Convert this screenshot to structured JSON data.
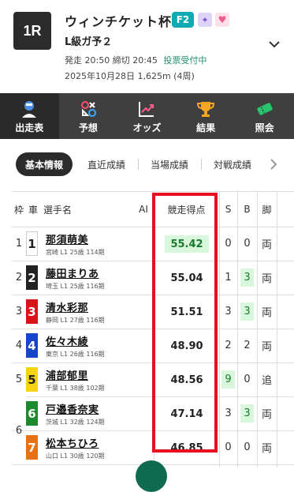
{
  "header": {
    "race_number": "1R",
    "title": "ウィンチケット杯",
    "grade": "F2",
    "race_name": "L級ガ予２",
    "start_time": "発走 20:50",
    "deadline": "締切 20:45",
    "vote_status": "投票受付中",
    "date_line": "2025年10月28日 1,625m (4周)"
  },
  "nav": [
    {
      "label": "出走表",
      "icon": "racer-icon",
      "active": true
    },
    {
      "label": "予想",
      "icon": "prediction-icon",
      "active": false
    },
    {
      "label": "オッズ",
      "icon": "odds-chart-icon",
      "active": false
    },
    {
      "label": "結果",
      "icon": "trophy-icon",
      "active": false
    },
    {
      "label": "照会",
      "icon": "ticket-icon",
      "active": false
    }
  ],
  "tabs": [
    "基本情報",
    "直近成績",
    "当場成績",
    "対戦成績"
  ],
  "table": {
    "headers": {
      "waku": "枠",
      "sha": "車",
      "racer": "選手名",
      "ai": "AI",
      "score": "競走得点",
      "s": "S",
      "b": "B",
      "kyaku": "脚"
    },
    "rows": [
      {
        "waku": "1",
        "car": "1",
        "name": "那須萌美",
        "info": "宮崎 L1 25歳 114期",
        "score": "55.42",
        "s": "0",
        "b": "0",
        "kyaku": "両"
      },
      {
        "waku": "2",
        "car": "2",
        "name": "藤田まりあ",
        "info": "埼玉 L1 25歳 116期",
        "score": "55.04",
        "s": "1",
        "b": "3",
        "kyaku": "両"
      },
      {
        "waku": "3",
        "car": "3",
        "name": "清水彩那",
        "info": "静岡 L1 27歳 116期",
        "score": "51.51",
        "s": "3",
        "b": "3",
        "kyaku": "両"
      },
      {
        "waku": "4",
        "car": "4",
        "name": "佐々木綾",
        "info": "東京 L1 26歳 116期",
        "score": "48.90",
        "s": "2",
        "b": "2",
        "kyaku": "両"
      },
      {
        "waku": "5",
        "car": "5",
        "name": "浦部郁里",
        "info": "千葉 L1 38歳 102期",
        "score": "48.56",
        "s": "9",
        "b": "0",
        "kyaku": "追"
      },
      {
        "waku": "6",
        "car": "6",
        "name": "戸邉香奈実",
        "info": "茨城 L1 32歳 124期",
        "score": "47.14",
        "s": "3",
        "b": "3",
        "kyaku": "両"
      },
      {
        "waku": "",
        "car": "7",
        "name": "松本ちひろ",
        "info": "山口 L1 30歳 120期",
        "score": "46.85",
        "s": "0",
        "b": "0",
        "kyaku": "両"
      }
    ]
  },
  "colors": {
    "car_1": "#ffffff",
    "car_2": "#222222",
    "car_3": "#d7141a",
    "car_4": "#1645c9",
    "car_5": "#f7d413",
    "car_6": "#1e8a2e",
    "car_7": "#e87211",
    "highlight_green": "#d9f7dc",
    "red_box": "#e8101e"
  }
}
